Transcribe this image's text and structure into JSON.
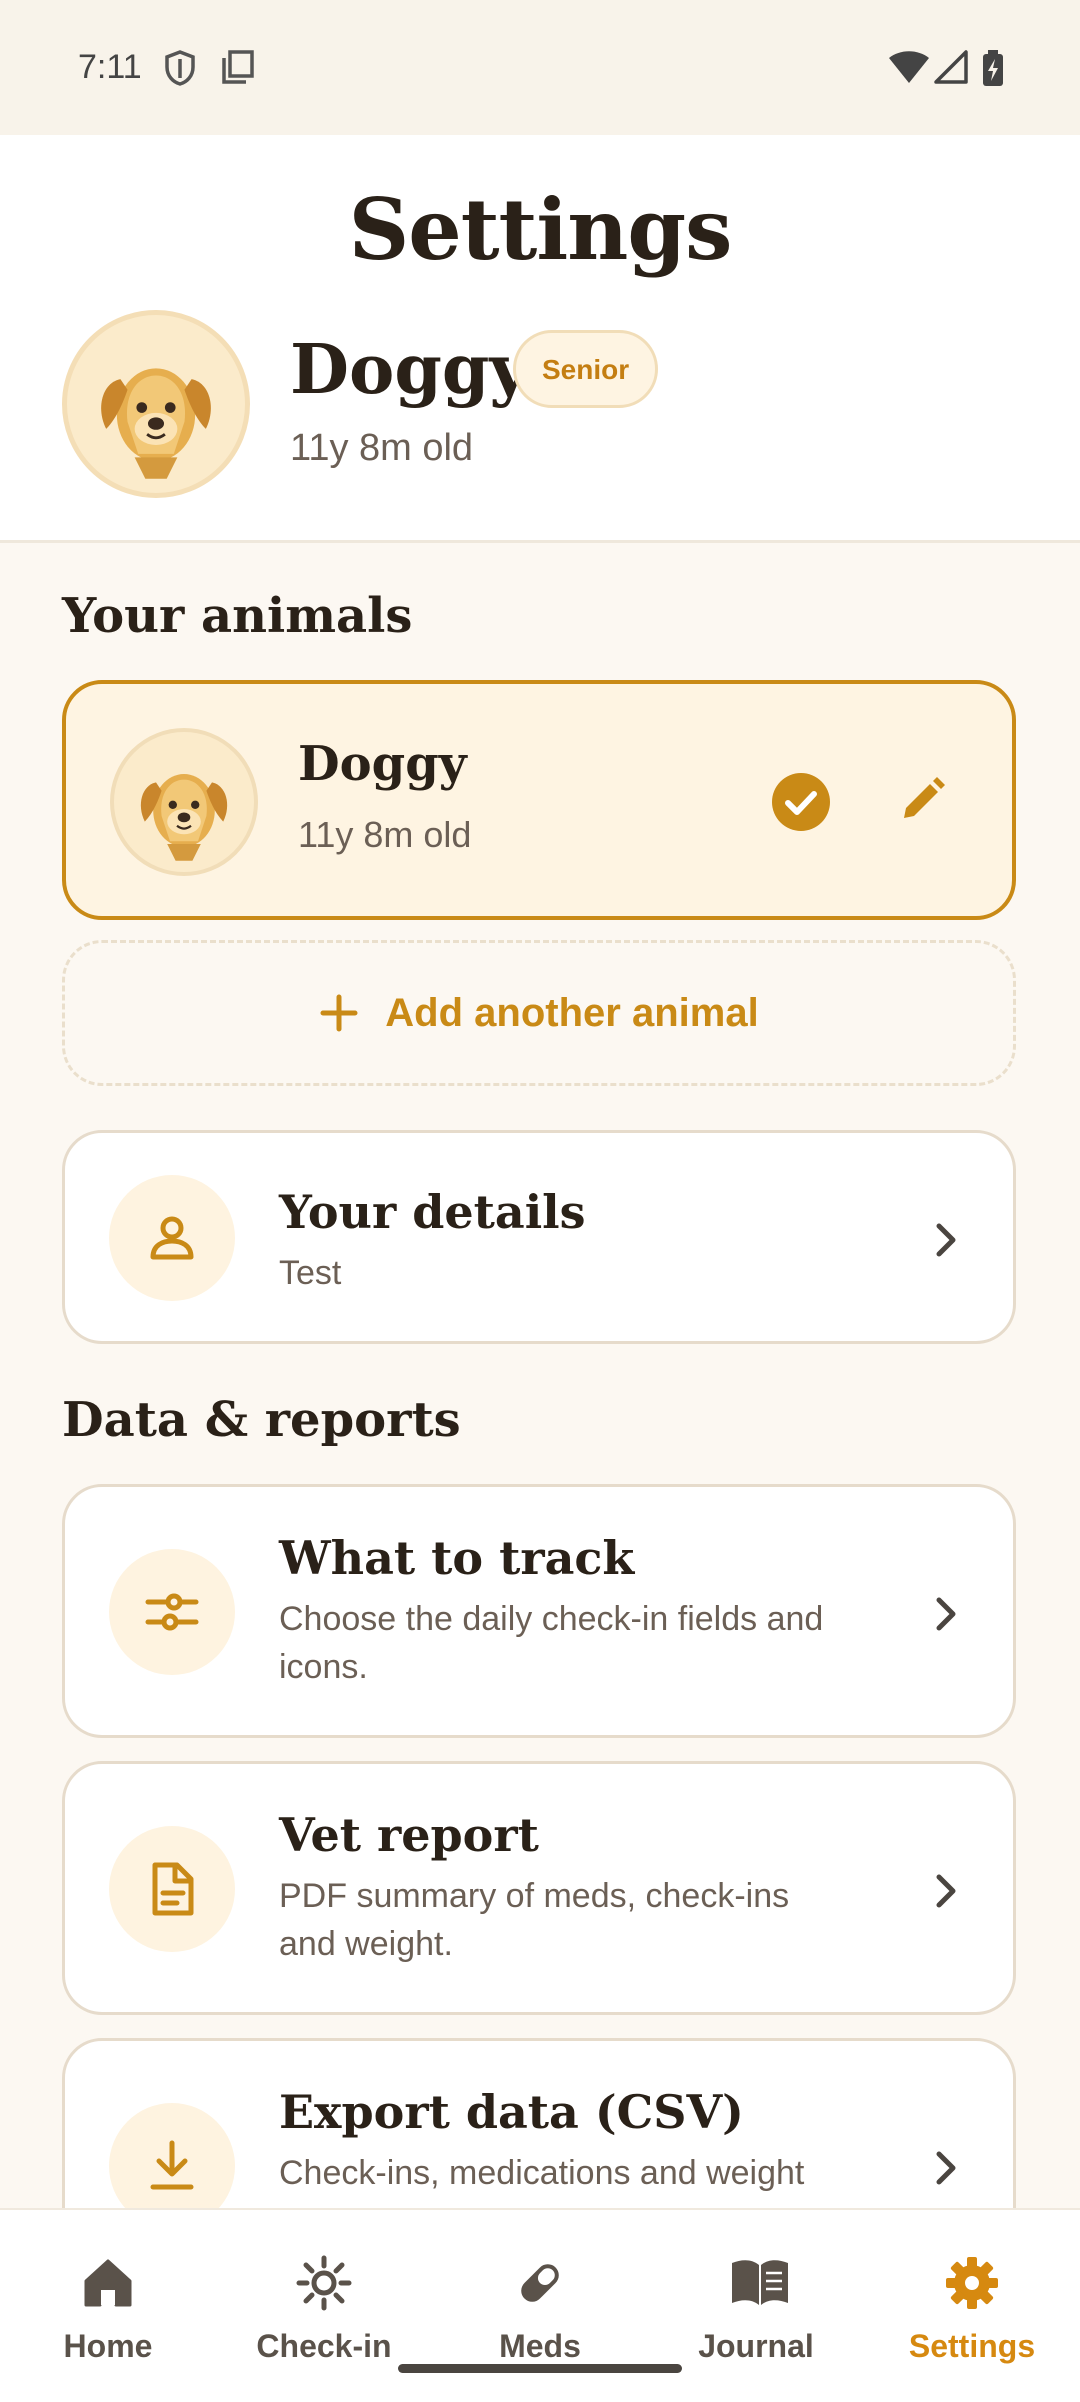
{
  "status_bar": {
    "time": "7:11"
  },
  "header": {
    "title": "Settings",
    "pet_name": "Doggy",
    "badge": "Senior",
    "pet_age": "11y 8m old"
  },
  "animals_section": {
    "title": "Your animals",
    "animals": [
      {
        "name": "Doggy",
        "age": "11y 8m old"
      }
    ],
    "add_label": "Add another animal"
  },
  "your_details": {
    "title": "Your details",
    "subtitle": "Test"
  },
  "data_section": {
    "title": "Data & reports",
    "items": [
      {
        "title": "What to track",
        "subtitle": "Choose the daily check-in fields and icons."
      },
      {
        "title": "Vet report",
        "subtitle": "PDF summary of meds, check-ins and weight."
      },
      {
        "title": "Export data (CSV)",
        "subtitle": "Check-ins, medications and weight"
      }
    ]
  },
  "nav": {
    "items": [
      {
        "label": "Home",
        "icon": "home-icon"
      },
      {
        "label": "Check-in",
        "icon": "sun-icon"
      },
      {
        "label": "Meds",
        "icon": "pill-icon"
      },
      {
        "label": "Journal",
        "icon": "book-icon"
      },
      {
        "label": "Settings",
        "icon": "gear-icon",
        "active": true
      }
    ]
  },
  "colors": {
    "accent": "#C98A16",
    "background": "#FCF8F2",
    "accent_soft": "#FEF4E2"
  }
}
